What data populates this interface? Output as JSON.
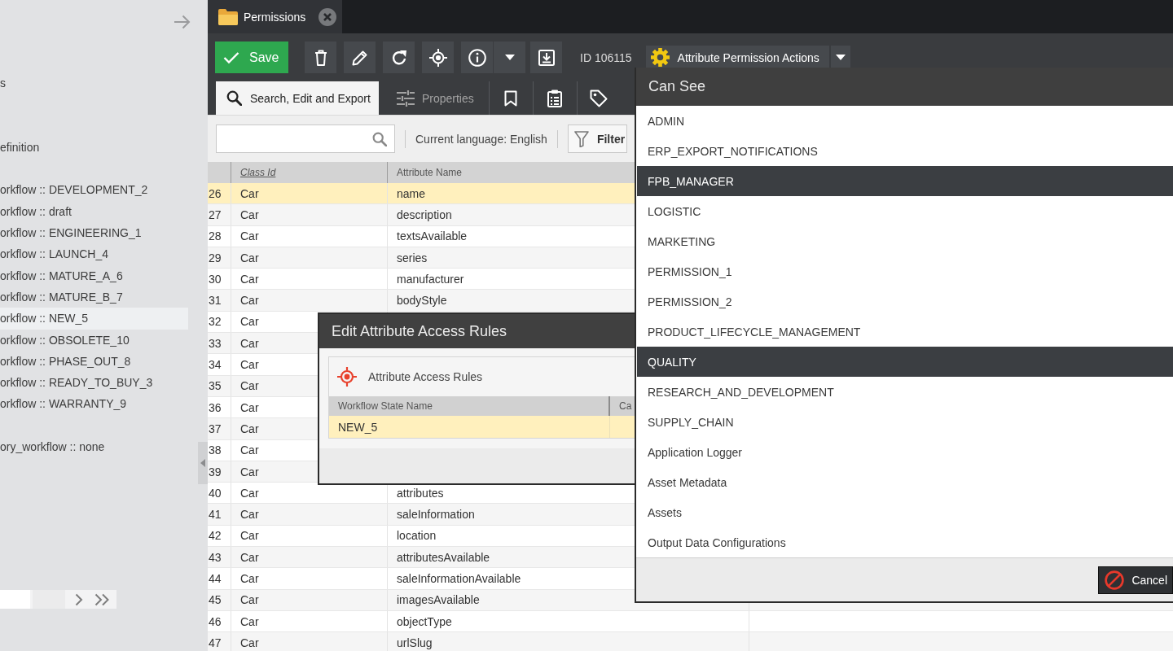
{
  "sidebar": {
    "groups": [
      {
        "items": [
          {
            "label": "s",
            "selected": false
          }
        ]
      },
      {
        "items": [
          {
            "label": "efinition",
            "selected": false
          }
        ]
      },
      {
        "items": [
          {
            "label": "orkflow :: DEVELOPMENT_2",
            "selected": false
          },
          {
            "label": "orkflow :: draft",
            "selected": false
          },
          {
            "label": "orkflow :: ENGINEERING_1",
            "selected": false
          },
          {
            "label": "orkflow :: LAUNCH_4",
            "selected": false
          },
          {
            "label": "orkflow :: MATURE_A_6",
            "selected": false
          },
          {
            "label": "orkflow :: MATURE_B_7",
            "selected": false
          },
          {
            "label": "orkflow :: NEW_5",
            "selected": true
          },
          {
            "label": "orkflow :: OBSOLETE_10",
            "selected": false
          },
          {
            "label": "orkflow :: PHASE_OUT_8",
            "selected": false
          },
          {
            "label": "orkflow :: READY_TO_BUY_3",
            "selected": false
          },
          {
            "label": "orkflow :: WARRANTY_9",
            "selected": false
          }
        ]
      },
      {
        "items": [
          {
            "label": "ory_workflow :: none",
            "selected": false
          }
        ]
      }
    ]
  },
  "document_tabs": [
    {
      "label": "Permissions",
      "selected": true
    }
  ],
  "toolbar": {
    "save_label": "Save",
    "id_text": "ID 106115",
    "actions_label": "Attribute Permission Actions"
  },
  "view_tabs": [
    {
      "kind": "search",
      "label": "Search, Edit and Export",
      "selected": true,
      "disabled": false
    },
    {
      "kind": "properties",
      "label": "Properties",
      "selected": false,
      "disabled": true
    },
    {
      "kind": "bookmark",
      "selected": false,
      "disabled": false
    },
    {
      "kind": "clipboard",
      "selected": false,
      "disabled": false
    },
    {
      "kind": "tag",
      "selected": false,
      "disabled": false
    }
  ],
  "filter_bar": {
    "language": "Current language: English",
    "filter_label": "Filter"
  },
  "table": {
    "columns": [
      {
        "label": "Class Id",
        "sorted": true
      },
      {
        "label": "Attribute Name",
        "sorted": false
      }
    ],
    "rows": [
      {
        "number": "26",
        "class_id": "Car",
        "attribute_name": "name",
        "selected": true
      },
      {
        "number": "27",
        "class_id": "Car",
        "attribute_name": "description",
        "selected": false
      },
      {
        "number": "28",
        "class_id": "Car",
        "attribute_name": "textsAvailable",
        "selected": false
      },
      {
        "number": "29",
        "class_id": "Car",
        "attribute_name": "series",
        "selected": false
      },
      {
        "number": "30",
        "class_id": "Car",
        "attribute_name": "manufacturer",
        "selected": false
      },
      {
        "number": "31",
        "class_id": "Car",
        "attribute_name": "bodyStyle",
        "selected": false
      },
      {
        "number": "32",
        "class_id": "Car",
        "selected": false
      },
      {
        "number": "33",
        "class_id": "Car",
        "selected": false
      },
      {
        "number": "34",
        "class_id": "Car",
        "selected": false
      },
      {
        "number": "35",
        "class_id": "Car",
        "selected": false
      },
      {
        "number": "36",
        "class_id": "Car",
        "selected": false
      },
      {
        "number": "37",
        "class_id": "Car",
        "selected": false
      },
      {
        "number": "38",
        "class_id": "Car",
        "selected": false
      },
      {
        "number": "39",
        "class_id": "Car",
        "selected": false
      },
      {
        "number": "40",
        "class_id": "Car",
        "attribute_name": "attributes",
        "selected": false
      },
      {
        "number": "41",
        "class_id": "Car",
        "attribute_name": "saleInformation",
        "selected": false
      },
      {
        "number": "42",
        "class_id": "Car",
        "attribute_name": "location",
        "selected": false
      },
      {
        "number": "43",
        "class_id": "Car",
        "attribute_name": "attributesAvailable",
        "selected": false
      },
      {
        "number": "44",
        "class_id": "Car",
        "attribute_name": "saleInformationAvailable",
        "selected": false
      },
      {
        "number": "45",
        "class_id": "Car",
        "attribute_name": "imagesAvailable",
        "selected": false
      },
      {
        "number": "46",
        "class_id": "Car",
        "attribute_name": "objectType",
        "selected": false
      },
      {
        "number": "47",
        "class_id": "Car",
        "attribute_name": "urlSlug",
        "selected": false
      }
    ]
  },
  "dialog": {
    "title": "Edit Attribute Access Rules",
    "panel_title": "Attribute Access Rules",
    "columns": [
      "Workflow State Name",
      "Ca"
    ],
    "rows": [
      {
        "state": "NEW_5",
        "selected": true
      }
    ]
  },
  "can_see": {
    "title": "Can See",
    "items": [
      {
        "label": "ADMIN",
        "selected": false
      },
      {
        "label": "ERP_EXPORT_NOTIFICATIONS",
        "selected": false
      },
      {
        "label": "FPB_MANAGER",
        "selected": true
      },
      {
        "label": "LOGISTIC",
        "selected": false
      },
      {
        "label": "MARKETING",
        "selected": false
      },
      {
        "label": "PERMISSION_1",
        "selected": false
      },
      {
        "label": "PERMISSION_2",
        "selected": false
      },
      {
        "label": "PRODUCT_LIFECYCLE_MANAGEMENT",
        "selected": false
      },
      {
        "label": "QUALITY",
        "selected": true
      },
      {
        "label": "RESEARCH_AND_DEVELOPMENT",
        "selected": false
      },
      {
        "label": "SUPPLY_CHAIN",
        "selected": false
      },
      {
        "label": "Application Logger",
        "selected": false
      },
      {
        "label": "Asset Metadata",
        "selected": false
      },
      {
        "label": "Assets",
        "selected": false
      },
      {
        "label": "Output Data Configurations",
        "selected": false
      }
    ],
    "cancel_label": "Cancel"
  }
}
